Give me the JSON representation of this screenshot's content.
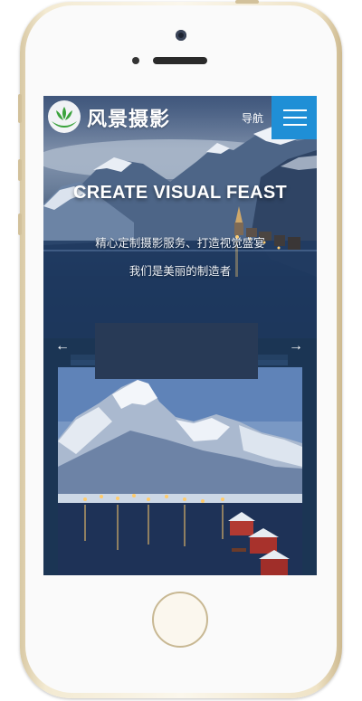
{
  "header": {
    "logo_text": "风景摄影",
    "nav_label": "导航"
  },
  "hero": {
    "title": "CREATE VISUAL FEAST",
    "subtitle_1": "精心定制摄影服务、打造视觉盛宴",
    "subtitle_2": "我们是美丽的制造者"
  },
  "slider": {
    "prev_icon": "←",
    "next_icon": "→"
  },
  "colors": {
    "menu_button": "#1f8fd6",
    "logo_green": "#3aa23c",
    "screen_bg": "#1b3554"
  }
}
